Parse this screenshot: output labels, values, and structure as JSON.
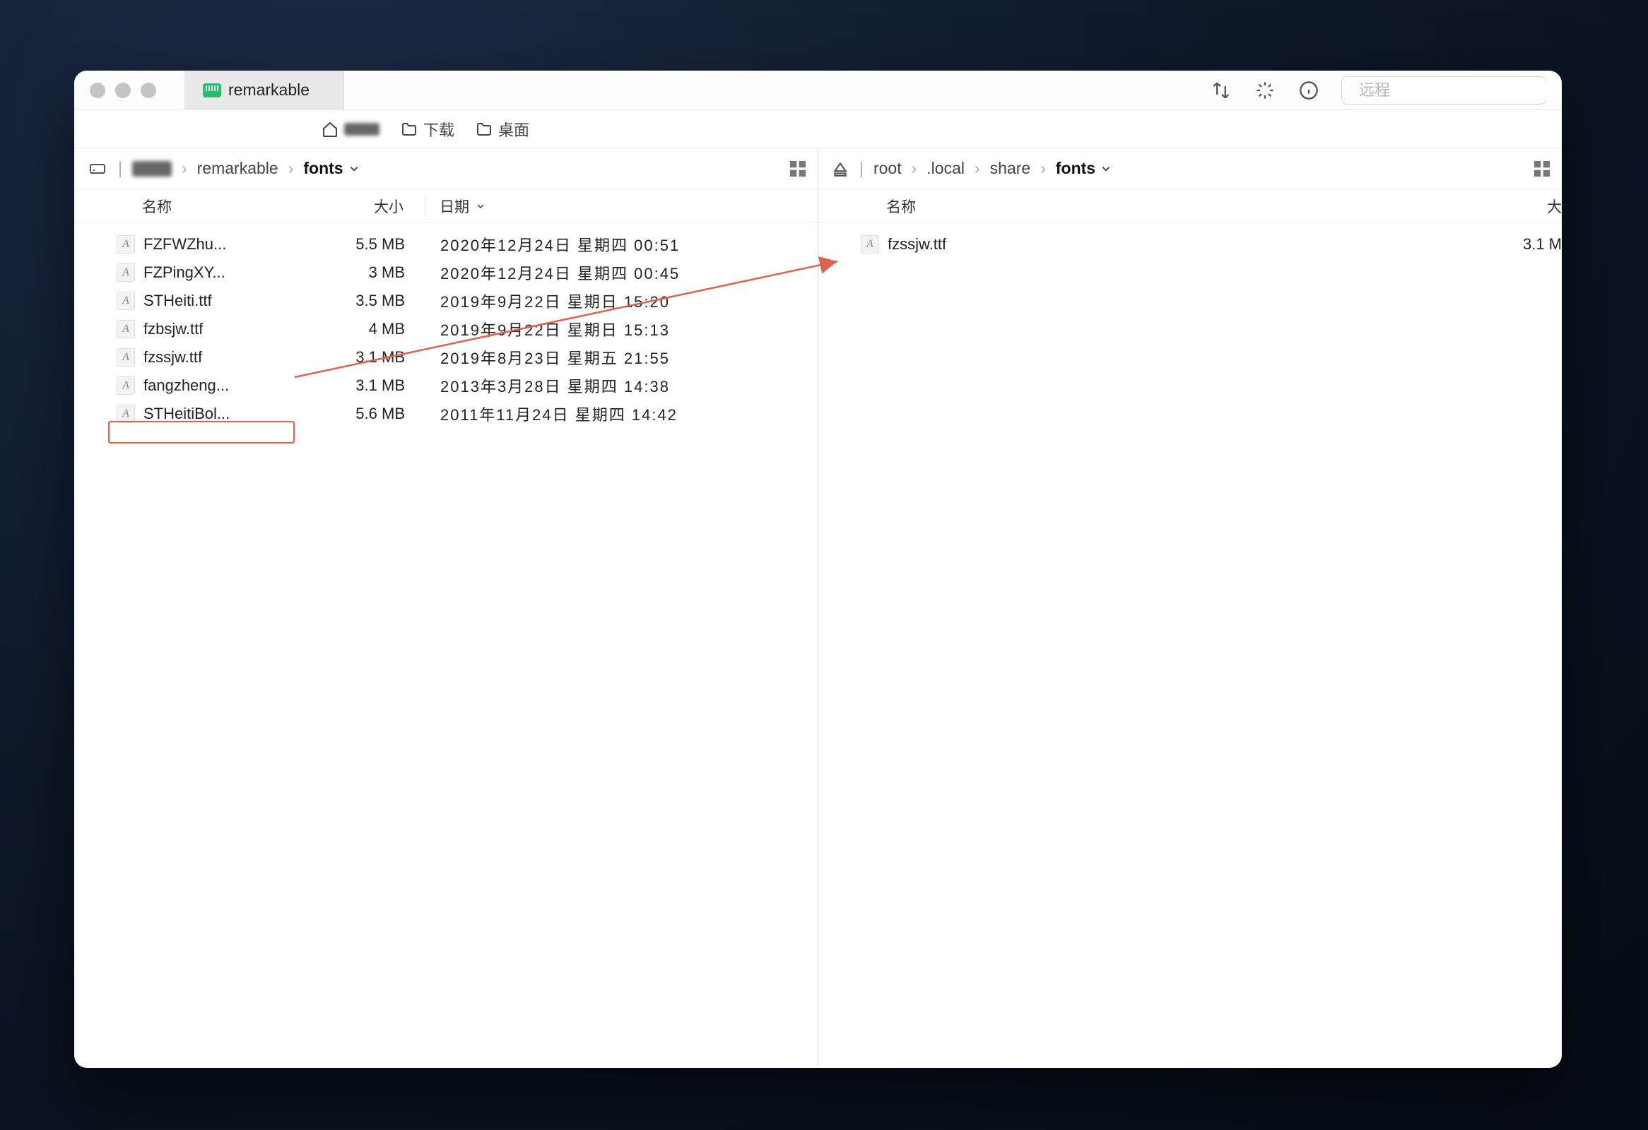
{
  "tab": {
    "label": "remarkable"
  },
  "toolbar": {
    "search_placeholder": "远程"
  },
  "favorites": {
    "home_label": "",
    "downloads_label": "下载",
    "desktop_label": "桌面"
  },
  "left": {
    "breadcrumbs": [
      "remarkable",
      "fonts"
    ],
    "columns": {
      "name": "名称",
      "size": "大小",
      "date": "日期"
    },
    "files": [
      {
        "name": "FZFWZhu...",
        "size": "5.5 MB",
        "date": "2020年12月24日 星期四 00:51"
      },
      {
        "name": "FZPingXY...",
        "size": "3 MB",
        "date": "2020年12月24日 星期四 00:45"
      },
      {
        "name": "STHeiti.ttf",
        "size": "3.5 MB",
        "date": "2019年9月22日 星期日 15:20"
      },
      {
        "name": "fzbsjw.ttf",
        "size": "4 MB",
        "date": "2019年9月22日 星期日 15:13"
      },
      {
        "name": "fzssjw.ttf",
        "size": "3.1 MB",
        "date": "2019年8月23日 星期五 21:55"
      },
      {
        "name": "fangzheng...",
        "size": "3.1 MB",
        "date": "2013年3月28日 星期四 14:38"
      },
      {
        "name": "STHeitiBol...",
        "size": "5.6 MB",
        "date": "2011年11月24日 星期四 14:42"
      }
    ],
    "highlighted_index": 4
  },
  "right": {
    "breadcrumbs": [
      "root",
      ".local",
      "share",
      "fonts"
    ],
    "columns": {
      "name": "名称",
      "size": "大"
    },
    "files": [
      {
        "name": "fzssjw.ttf",
        "size": "3.1 M"
      }
    ]
  }
}
